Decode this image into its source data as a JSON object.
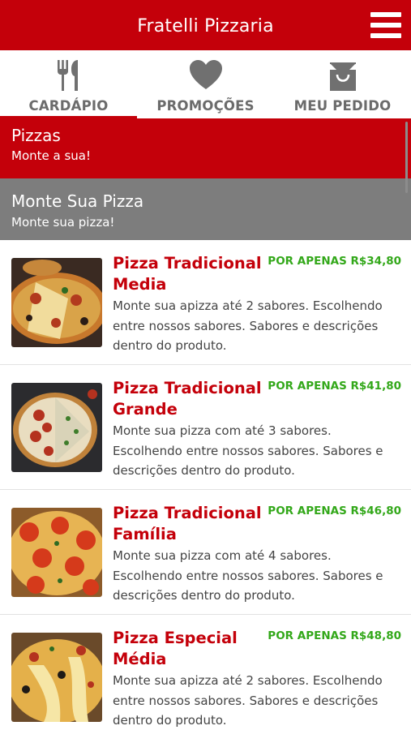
{
  "header": {
    "title": "Fratelli Pizzaria",
    "menu_icon": "hamburger-menu-icon"
  },
  "tabs": [
    {
      "label": "CARDÁPIO",
      "icon": "fork-knife-icon",
      "active": true
    },
    {
      "label": "PROMOÇÕES",
      "icon": "heart-icon",
      "active": false
    },
    {
      "label": "MEU PEDIDO",
      "icon": "shopping-bag-icon",
      "active": false
    }
  ],
  "categories": [
    {
      "title": "Pizzas",
      "subtitle": "Monte a sua!",
      "color": "#c4000a"
    },
    {
      "title": "Monte Sua Pizza",
      "subtitle": "Monte sua pizza!",
      "color": "#7d7d7d"
    }
  ],
  "products": [
    {
      "name": "Pizza Tradicional Media",
      "price": "POR APENAS R$34,80",
      "description": "Monte sua apizza até 2 sabores. Escolhendo entre nossos sabores. Sabores e descrições dentro do produto."
    },
    {
      "name": "Pizza Tradicional Grande",
      "price": "POR APENAS R$41,80",
      "description": "Monte sua pizza com até 3 sabores. Escolhendo entre nossos sabores. Sabores e descrições dentro do produto."
    },
    {
      "name": "Pizza Tradicional Família",
      "price": "POR APENAS R$46,80",
      "description": "Monte sua pizza com até 4 sabores. Escolhendo entre nossos sabores. Sabores e descrições dentro do produto."
    },
    {
      "name": "Pizza Especial Média",
      "price": "POR APENAS R$48,80",
      "description": "Monte sua apizza até 2 sabores. Escolhendo entre nossos sabores. Sabores e descrições dentro do produto."
    }
  ],
  "colors": {
    "brand_red": "#c4000a",
    "price_green": "#33a81a",
    "gray_banner": "#7d7d7d"
  }
}
